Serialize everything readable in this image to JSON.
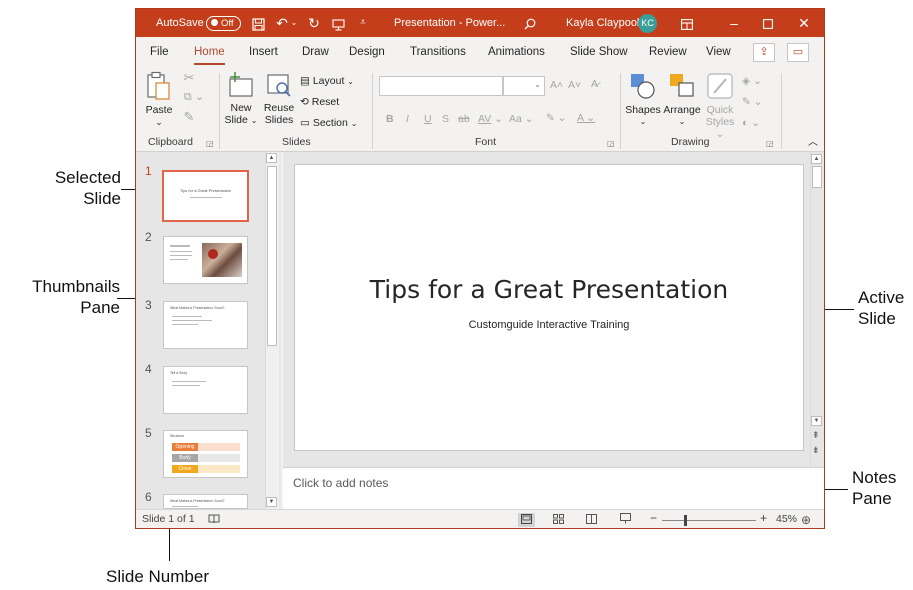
{
  "callouts": {
    "selected_slide": [
      "Selected",
      "Slide"
    ],
    "thumbnails_pane": [
      "Thumbnails",
      "Pane"
    ],
    "active_slide": [
      "Active",
      "Slide"
    ],
    "notes_pane": [
      "Notes",
      "Pane"
    ],
    "slide_number": "Slide Number"
  },
  "titlebar": {
    "autosave_label": "AutoSave",
    "autosave_state": "Off",
    "title": "Presentation - Power...",
    "user_name": "Kayla Claypool",
    "user_initials": "KC"
  },
  "tabs": [
    "File",
    "Home",
    "Insert",
    "Draw",
    "Design",
    "Transitions",
    "Animations",
    "Slide Show",
    "Review",
    "View"
  ],
  "active_tab": "Home",
  "ribbon": {
    "clipboard": {
      "paste": "Paste",
      "group": "Clipboard"
    },
    "slides": {
      "new_slide": [
        "New",
        "Slide"
      ],
      "reuse_slides": [
        "Reuse",
        "Slides"
      ],
      "layout": "Layout",
      "reset": "Reset",
      "section": "Section",
      "group": "Slides"
    },
    "font": {
      "group": "Font",
      "grow": "A˄",
      "shrink": "A˅",
      "bold": "B",
      "italic": "I",
      "underline": "U",
      "shadow": "S",
      "strike": "ab",
      "spacing": "AV",
      "case": "Aa"
    },
    "drawing": {
      "shapes": "Shapes",
      "arrange": "Arrange",
      "quick_styles": [
        "Quick",
        "Styles"
      ],
      "group": "Drawing"
    }
  },
  "thumbnails": [
    {
      "num": "1",
      "title": "Tips for a Great Presentation"
    },
    {
      "num": "2",
      "title": ""
    },
    {
      "num": "3",
      "title": "What Makes a Presentation Good?"
    },
    {
      "num": "4",
      "title": "Tell a Story"
    },
    {
      "num": "5",
      "title": "Structure",
      "bars": [
        "Opening",
        "Body",
        "Close"
      ]
    },
    {
      "num": "6",
      "title": "What Makes a Presentation Good?"
    }
  ],
  "slide": {
    "title": "Tips for a Great Presentation",
    "subtitle": "Customguide Interactive Training"
  },
  "notes_placeholder": "Click to add notes",
  "status": {
    "slide_count": "Slide 1 of 1",
    "zoom": "45%",
    "zoom_fraction": 0.45
  },
  "colors": {
    "accent": "#c43e1c",
    "selected_thumb": "#e0654a",
    "avatar": "#3a9e9a",
    "bar_opening": "#ea7d3a",
    "bar_body": "#a6a6a6",
    "bar_close": "#f0a81e"
  }
}
